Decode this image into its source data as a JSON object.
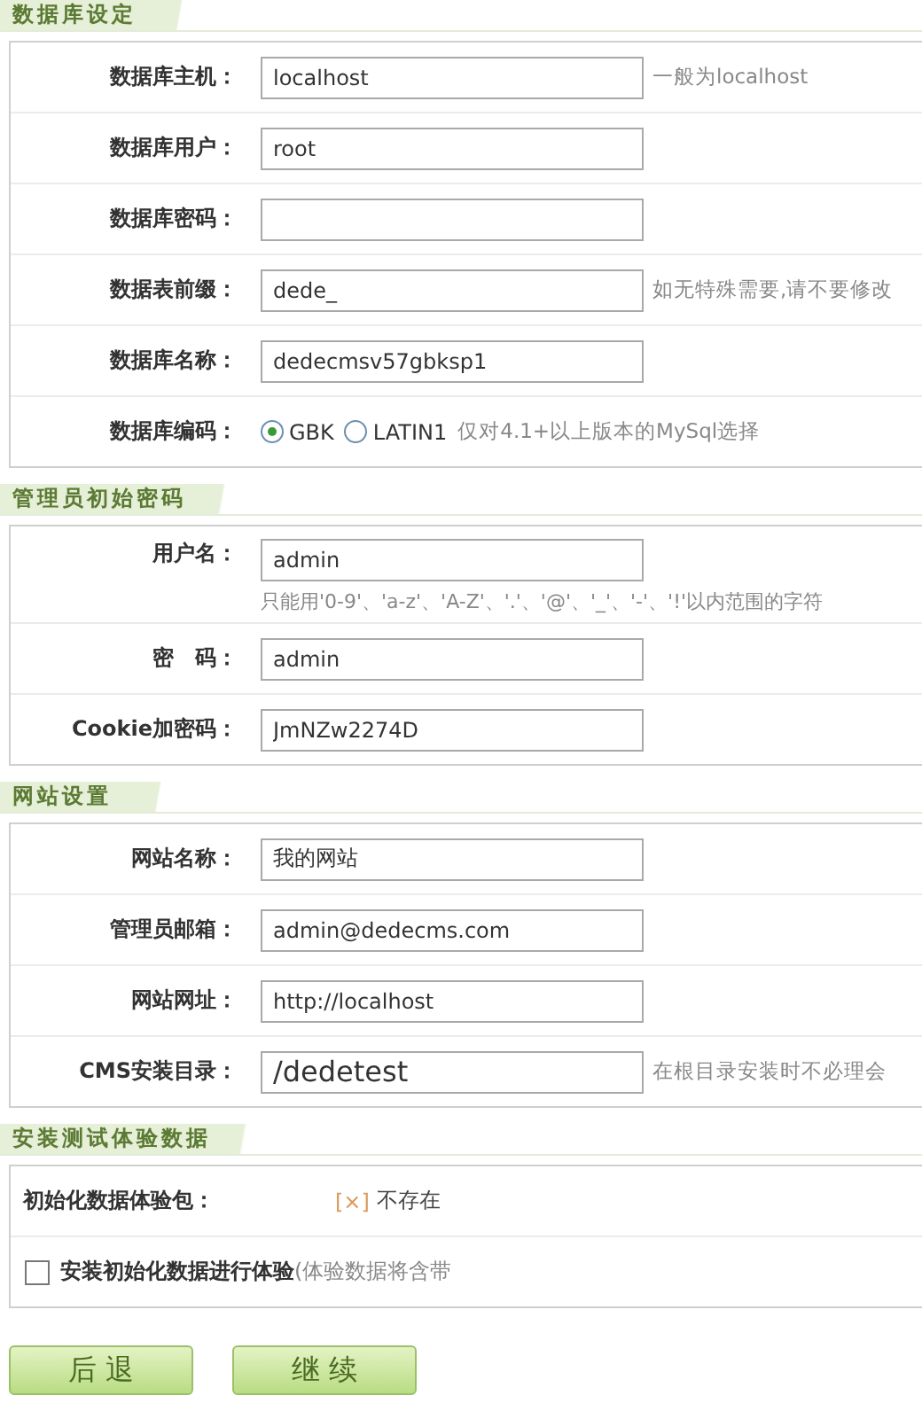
{
  "sections": [
    {
      "title": "数据库设定",
      "rows": [
        {
          "kind": "text",
          "label": "数据库主机：",
          "value": "localhost",
          "hint": "一般为localhost"
        },
        {
          "kind": "text",
          "label": "数据库用户：",
          "value": "root"
        },
        {
          "kind": "text",
          "label": "数据库密码："
        },
        {
          "kind": "text",
          "label": "数据表前缀：",
          "value": "dede_",
          "hint": "如无特殊需要,请不要修改"
        },
        {
          "kind": "text",
          "label": "数据库名称：",
          "value": "dedecmsv57gbksp1"
        },
        {
          "kind": "radio",
          "label": "数据库编码：",
          "options": [
            {
              "label": "GBK",
              "selected": true
            },
            {
              "label": "LATIN1",
              "selected": false
            }
          ],
          "hint": "仅对4.1+以上版本的MySql选择"
        }
      ]
    },
    {
      "title": "管理员初始密码",
      "rows": [
        {
          "kind": "text",
          "label": "用户名：",
          "value": "admin",
          "note": "只能用'0-9'、'a-z'、'A-Z'、'.'、'@'、'_'、'-'、'!'以内范围的字符"
        },
        {
          "kind": "text",
          "label": "密　码：",
          "value": "admin"
        },
        {
          "kind": "text",
          "label": "Cookie加密码：",
          "value": "JmNZw2274D"
        }
      ]
    },
    {
      "title": "网站设置",
      "rows": [
        {
          "kind": "text",
          "label": "网站名称：",
          "value": "我的网站"
        },
        {
          "kind": "text",
          "label": "管理员邮箱：",
          "value": "admin@dedecms.com"
        },
        {
          "kind": "text",
          "label": "网站网址：",
          "value": "http://localhost"
        },
        {
          "kind": "text",
          "label": "CMS安装目录：",
          "value": "/dedetest",
          "large": true,
          "hint": "在根目录安装时不必理会"
        }
      ]
    },
    {
      "title": "安装测试体验数据",
      "rows": [
        {
          "kind": "status",
          "label": "初始化数据体验包：",
          "mark": "[×]",
          "status": "不存在"
        },
        {
          "kind": "checkbox",
          "label": "安装初始化数据进行体验",
          "note": "(体验数据将含带",
          "checked": false
        }
      ]
    }
  ],
  "buttons": [
    "后 退",
    "继 续"
  ]
}
